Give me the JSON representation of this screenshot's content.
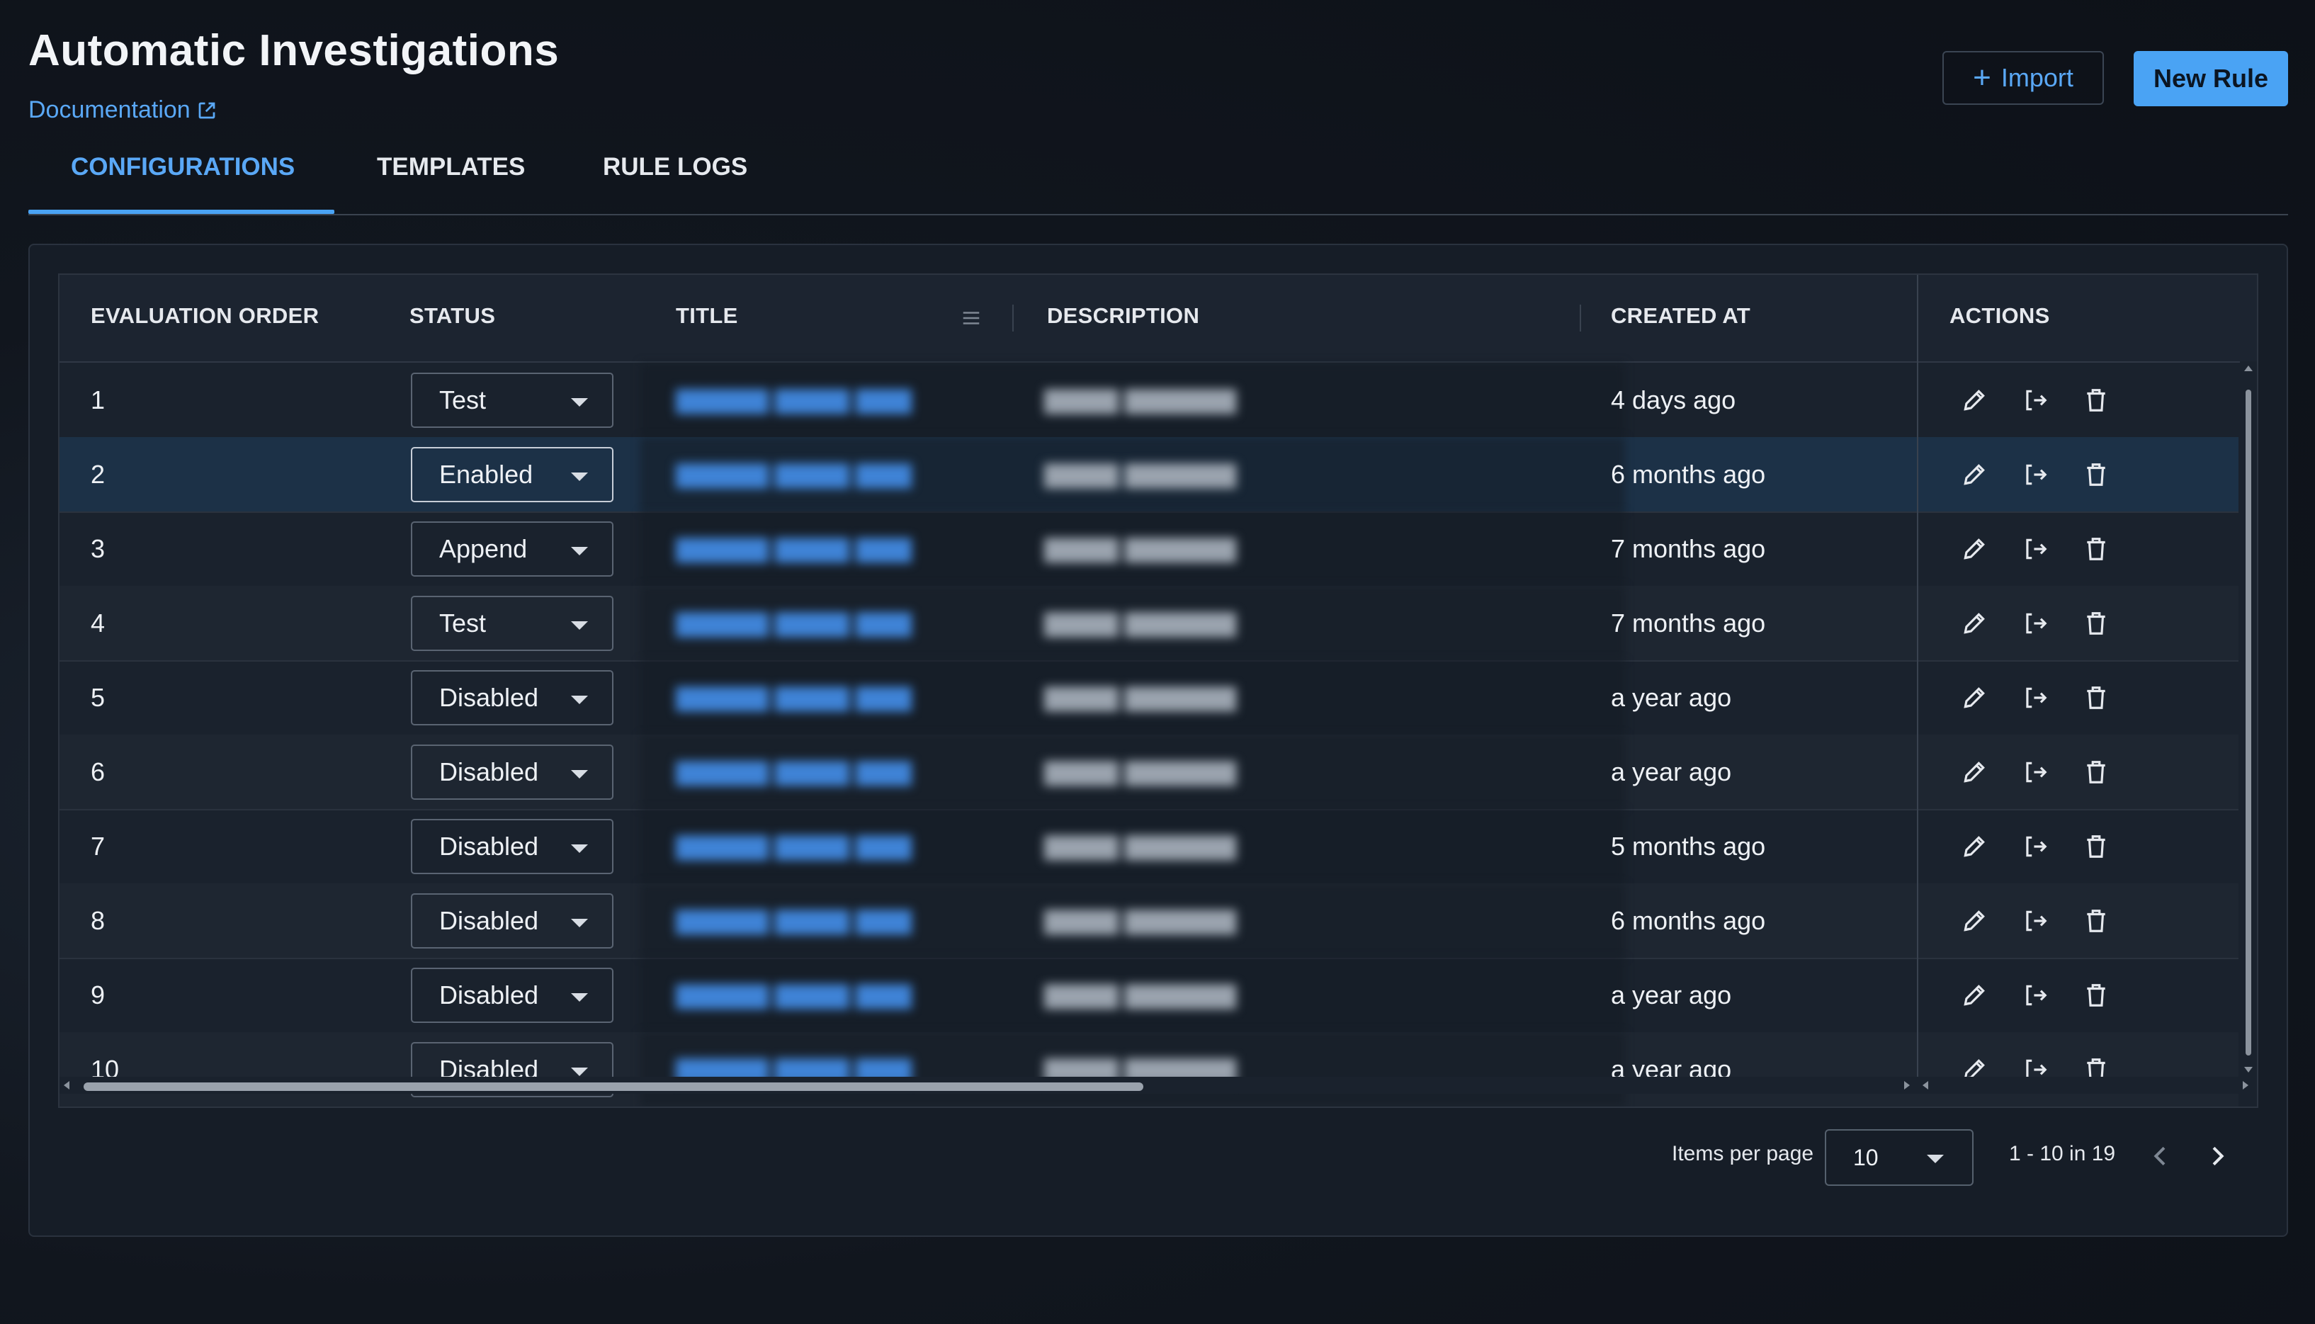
{
  "header": {
    "title": "Automatic Investigations",
    "documentation_label": "Documentation",
    "import_label": "Import",
    "new_rule_label": "New Rule"
  },
  "tabs": [
    {
      "label": "CONFIGURATIONS",
      "active": true
    },
    {
      "label": "TEMPLATES",
      "active": false
    },
    {
      "label": "RULE LOGS",
      "active": false
    }
  ],
  "table": {
    "columns": [
      "EVALUATION ORDER",
      "STATUS",
      "TITLE",
      "DESCRIPTION",
      "CREATED AT",
      "ACTIONS"
    ],
    "rows": [
      {
        "order": "1",
        "status": "Test",
        "created_at": "4 days ago"
      },
      {
        "order": "2",
        "status": "Enabled",
        "created_at": "6 months ago"
      },
      {
        "order": "3",
        "status": "Append",
        "created_at": "7 months ago"
      },
      {
        "order": "4",
        "status": "Test",
        "created_at": "7 months ago"
      },
      {
        "order": "5",
        "status": "Disabled",
        "created_at": "a year ago"
      },
      {
        "order": "6",
        "status": "Disabled",
        "created_at": "a year ago"
      },
      {
        "order": "7",
        "status": "Disabled",
        "created_at": "5 months ago"
      },
      {
        "order": "8",
        "status": "Disabled",
        "created_at": "6 months ago"
      },
      {
        "order": "9",
        "status": "Disabled",
        "created_at": "a year ago"
      },
      {
        "order": "10",
        "status": "Disabled",
        "created_at": "a year ago"
      }
    ]
  },
  "pagination": {
    "items_per_page_label": "Items per page",
    "items_per_page_value": "10",
    "range_label": "1 - 10 in 19"
  },
  "colors": {
    "accent": "#4aa3f4",
    "link": "#5aa8f6",
    "background": "#11161e",
    "row_highlight": "#1c3147"
  },
  "icons": [
    "external-link-icon",
    "plus-icon",
    "edit-icon",
    "export-icon",
    "delete-icon",
    "chevron-left-icon",
    "chevron-right-icon",
    "caret-down-icon",
    "column-menu-icon"
  ]
}
